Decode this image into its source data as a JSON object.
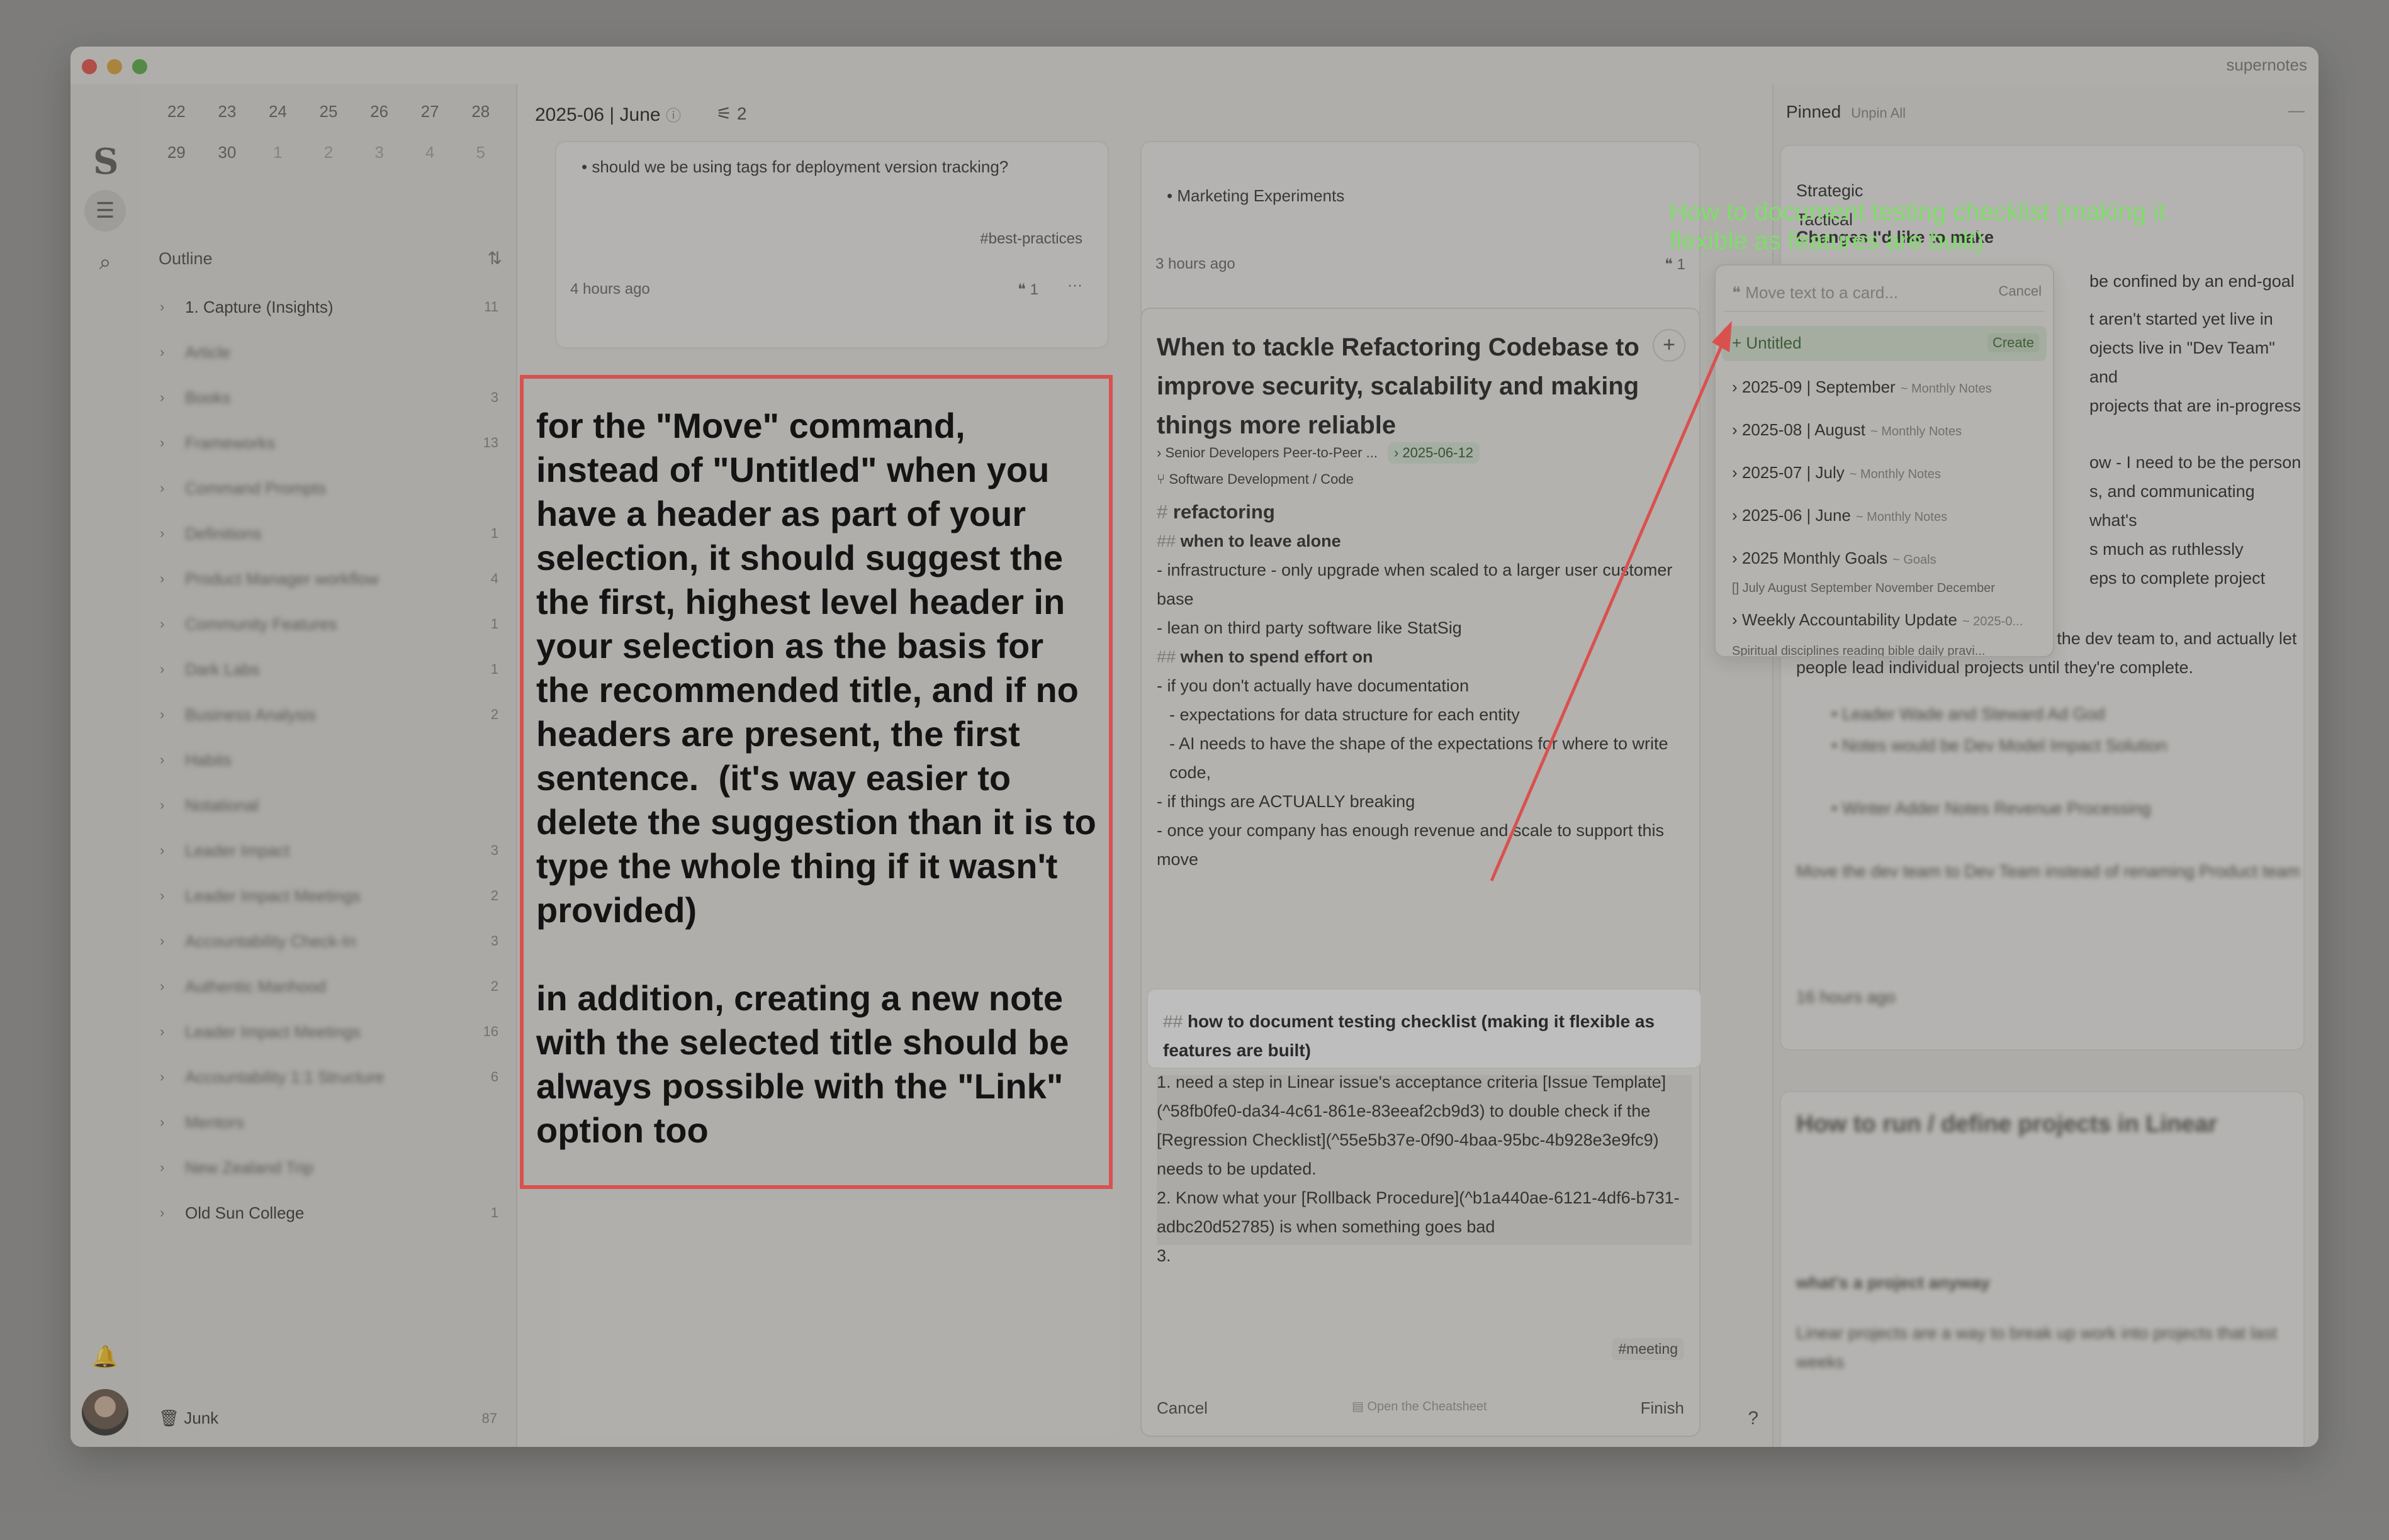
{
  "window": {
    "brand": "supernotes"
  },
  "sidebar": {
    "calendar": [
      {
        "day": "22"
      },
      {
        "day": "23"
      },
      {
        "day": "24"
      },
      {
        "day": "25"
      },
      {
        "day": "26"
      },
      {
        "day": "27"
      },
      {
        "day": "28"
      },
      {
        "day": "29"
      },
      {
        "day": "30"
      },
      {
        "day": "1"
      },
      {
        "day": "2"
      },
      {
        "day": "3"
      },
      {
        "day": "4"
      },
      {
        "day": "5"
      }
    ],
    "outline_title": "Outline",
    "tree": [
      {
        "label": "1. Capture (Insights)",
        "count": "11",
        "blur": false
      },
      {
        "label": "Article",
        "count": "",
        "blur": true
      },
      {
        "label": "Books",
        "count": "3",
        "blur": true
      },
      {
        "label": "Frameworks",
        "count": "13",
        "blur": true
      },
      {
        "label": "Command Prompts",
        "count": "",
        "blur": true
      },
      {
        "label": "Definitions",
        "count": "1",
        "blur": true
      },
      {
        "label": "Product Manager workflow",
        "count": "4",
        "blur": true
      },
      {
        "label": "Community Features",
        "count": "1",
        "blur": true
      },
      {
        "label": "Dark Labs",
        "count": "1",
        "blur": true
      },
      {
        "label": "Business Analysis",
        "count": "2",
        "blur": true
      },
      {
        "label": "Habits",
        "count": "",
        "blur": true
      },
      {
        "label": "Notational",
        "count": "",
        "blur": true
      },
      {
        "label": "Leader Impact",
        "count": "3",
        "blur": true
      },
      {
        "label": "Leader Impact Meetings",
        "count": "2",
        "blur": true
      },
      {
        "label": "Accountability Check-In",
        "count": "3",
        "blur": true
      },
      {
        "label": "Authentic Manhood",
        "count": "2",
        "blur": true
      },
      {
        "label": "Leader Impact Meetings",
        "count": "16",
        "blur": true
      },
      {
        "label": "Accountability 1:1 Structure",
        "count": "6",
        "blur": true
      },
      {
        "label": "Mentors",
        "count": "",
        "blur": true
      },
      {
        "label": "New Zealand Trip",
        "count": "",
        "blur": true
      },
      {
        "label": "Old Sun College",
        "count": "1",
        "blur": false
      }
    ],
    "junk_label": "Junk",
    "junk_count": "87"
  },
  "main": {
    "header_title": "2025-06 | June",
    "filter_count": "2",
    "card_a": {
      "bullet": "should we be using tags for deployment version tracking?",
      "tag": "#best-practices",
      "time": "4 hours ago",
      "refs": "1"
    },
    "card_b": {
      "bullet": "Marketing Experiments",
      "time": "3 hours ago",
      "refs": "1"
    },
    "editor": {
      "title": "When to tackle Refactoring Codebase to improve security, scalability and making things more reliable",
      "parent": "Senior Developers Peer-to-Peer ...",
      "date": "2025-06-12",
      "branch": "Software Development / Code",
      "h1": "refactoring",
      "h2a": "when to leave alone",
      "l1": "- infrastructure - only upgrade when scaled to a larger user customer base",
      "l2": "- lean on third party software like StatSig",
      "h2b": "when to spend effort on",
      "l3": "- if you don't actually have documentation",
      "l4": "- expectations for data structure for each entity",
      "l5": "- AI needs to have the shape of the expectations for where to write code,",
      "l6": "- if things are ACTUALLY breaking",
      "l7": "- once your company has enough revenue and scale to support this move",
      "selected_header": "how to document testing checklist (making it flexible as features are built)",
      "s1": "1. need a step in Linear issue's acceptance criteria [Issue Template](^58fb0fe0-da34-4c61-861e-83eeaf2cb9d3) to double check if the [Regression Checklist](^55e5b37e-0f90-4baa-95bc-4b928e3e9fc9) needs to be updated.",
      "s2": "2. Know what your [Rollback Procedure](^b1a440ae-6121-4df6-b731-adbc20d52785) is when something goes bad",
      "s3": "3.",
      "tag": "#meeting",
      "cancel": "Cancel",
      "cheatsheet": "Open the Cheatsheet",
      "finish": "Finish"
    }
  },
  "pinned": {
    "title": "Pinned",
    "unpin_all": "Unpin All",
    "strategic": "Strategic",
    "tactical": "Tactical",
    "changes": "Changes I'd like to make",
    "r1": "be confined by an end-goal",
    "r2": "t aren't started yet live in",
    "r3": "ojects live in \"Dev Team\" and",
    "r4": "projects that are in-progress",
    "r5": "ow - I need to be the person",
    "r6": "s, and communicating what's",
    "r7": "s much as ruthlessly",
    "r8": "eps to complete project",
    "r9": "4. I will create new projects to add the dev team to, and actually let people lead individual projects until they're complete.",
    "card2_title": "How to run / define projects in Linear",
    "card2_sub": "what's a project anyway"
  },
  "popup": {
    "placeholder": "Move text to a card...",
    "cancel": "Cancel",
    "untitled": "Untitled",
    "create": "Create",
    "items": [
      {
        "label": "2025-09 | September",
        "sub": "~ Monthly Notes"
      },
      {
        "label": "2025-08 | August",
        "sub": "~ Monthly Notes"
      },
      {
        "label": "2025-07 | July",
        "sub": "~ Monthly Notes"
      },
      {
        "label": "2025-06 | June",
        "sub": "~ Monthly Notes"
      },
      {
        "label": "2025 Monthly Goals",
        "sub": "~ Goals"
      },
      {
        "label": "Weekly Accountability Update",
        "sub": "~ 2025-0..."
      }
    ],
    "goals_sub": "[] July August September November December",
    "weekly_sub": "Spiritual disciplines reading bible daily pravi..."
  },
  "annotation": {
    "text": "for the \"Move\" command, instead of \"Untitled\" when you have a header as part of your selection, it should suggest the the first, highest level header in your selection as the basis for the recommended title, and if no headers are present, the first sentence.  (it's way easier to delete the suggestion than it is to type the whole thing if it wasn't provided)\n\nin addition, creating a new note with the selected title should be always possible with the \"Link\" option too",
    "green_label": "How to document testing checklist (making it flexible as features are built)",
    "color_red": "#d9514e",
    "color_green": "#7fdc6a"
  }
}
